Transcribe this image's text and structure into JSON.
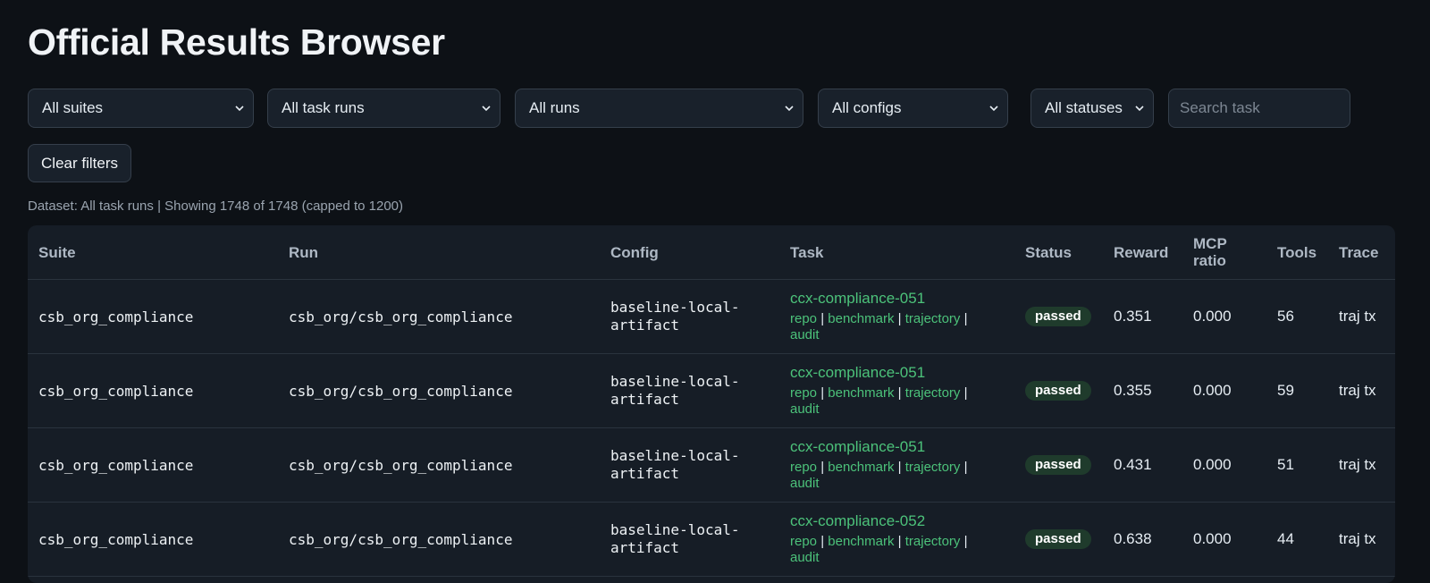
{
  "page_title": "Official Results Browser",
  "filters": {
    "suite": "All suites",
    "task_runs": "All task runs",
    "runs": "All runs",
    "configs": "All configs",
    "statuses": "All statuses",
    "search_placeholder": "Search task",
    "clear_label": "Clear filters"
  },
  "summary": "Dataset: All task runs | Showing 1748 of 1748 (capped to 1200)",
  "table": {
    "headers": {
      "suite": "Suite",
      "run": "Run",
      "config": "Config",
      "task": "Task",
      "status": "Status",
      "reward": "Reward",
      "mcp_ratio_1": "MCP",
      "mcp_ratio_2": "ratio",
      "tools": "Tools",
      "trace": "Trace"
    },
    "link_labels": {
      "repo": "repo",
      "benchmark": "benchmark",
      "trajectory": "trajectory",
      "audit": "audit",
      "sep": "|"
    },
    "rows": [
      {
        "suite": "csb_org_compliance",
        "run": "csb_org/csb_org_compliance",
        "config": "baseline-local-artifact",
        "task": "ccx-compliance-051",
        "status": "passed",
        "reward": "0.351",
        "mcp_ratio": "0.000",
        "tools": "56",
        "trace": "traj tx"
      },
      {
        "suite": "csb_org_compliance",
        "run": "csb_org/csb_org_compliance",
        "config": "baseline-local-artifact",
        "task": "ccx-compliance-051",
        "status": "passed",
        "reward": "0.355",
        "mcp_ratio": "0.000",
        "tools": "59",
        "trace": "traj tx"
      },
      {
        "suite": "csb_org_compliance",
        "run": "csb_org/csb_org_compliance",
        "config": "baseline-local-artifact",
        "task": "ccx-compliance-051",
        "status": "passed",
        "reward": "0.431",
        "mcp_ratio": "0.000",
        "tools": "51",
        "trace": "traj tx"
      },
      {
        "suite": "csb_org_compliance",
        "run": "csb_org/csb_org_compliance",
        "config": "baseline-local-artifact",
        "task": "ccx-compliance-052",
        "status": "passed",
        "reward": "0.638",
        "mcp_ratio": "0.000",
        "tools": "44",
        "trace": "traj tx"
      }
    ]
  },
  "colors": {
    "background": "#0d1116",
    "accent_green": "#4cc27a",
    "badge_bg": "#1f3b2c"
  },
  "icons": {
    "dropdown": "chevron-down-icon"
  }
}
